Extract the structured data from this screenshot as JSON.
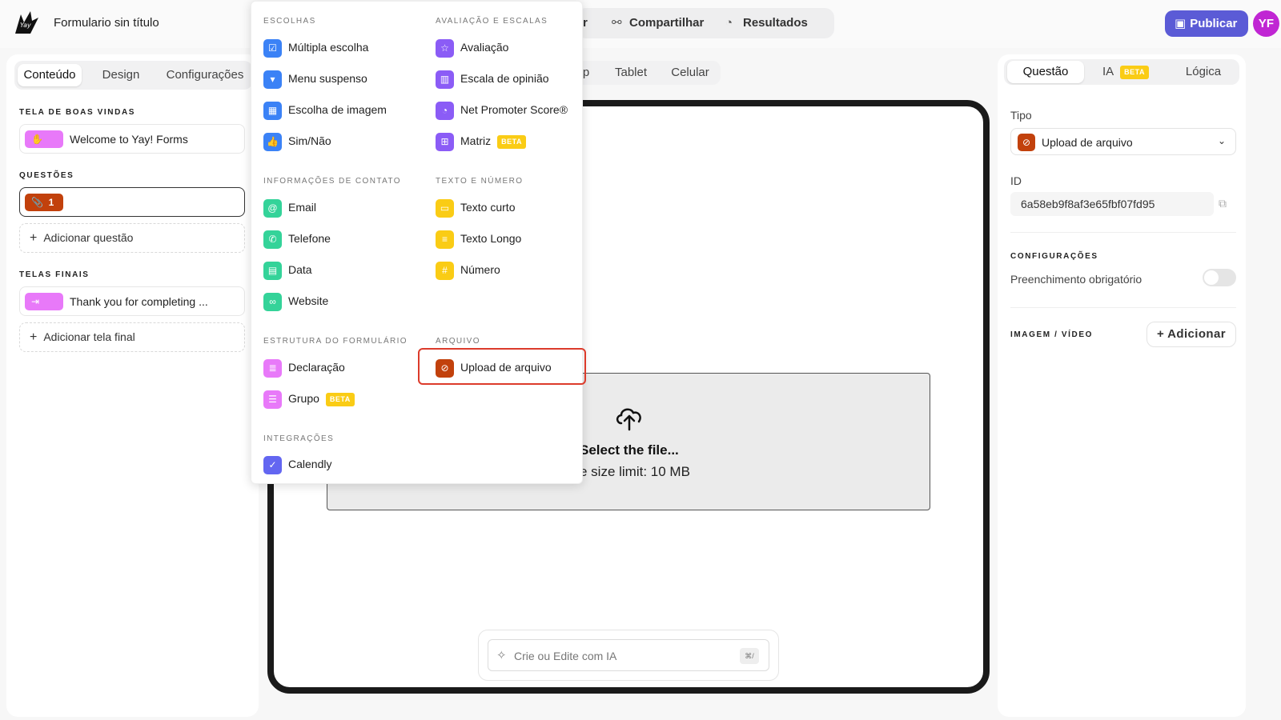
{
  "header": {
    "form_title": "Formulario sin título",
    "nav": [
      {
        "label": "r"
      },
      {
        "label": "Compartilhar",
        "icon": "share-icon"
      },
      {
        "label": "Resultados",
        "icon": "chart-pie-icon"
      }
    ],
    "publish_label": "Publicar",
    "avatar_initials": "YF",
    "accent_color": "#5b5bd6"
  },
  "left": {
    "tabs": [
      "Conteúdo",
      "Design",
      "Configurações"
    ],
    "welcome_label": "TELA DE BOAS VINDAS",
    "welcome_item": "Welcome to Yay! Forms",
    "questions_label": "QUESTÕES",
    "question_number": "1",
    "add_question": "Adicionar questão",
    "final_label": "TELAS FINAIS",
    "final_item": "Thank you for completing ...",
    "add_final": "Adicionar tela final"
  },
  "center": {
    "device_tabs": [
      "p",
      "Tablet",
      "Celular"
    ],
    "upload_title": "Select the file...",
    "upload_limit": "e size limit: 10 MB",
    "ai_placeholder": "Crie ou Edite com IA",
    "ai_shortcut": "⌘/"
  },
  "menu": {
    "sections": {
      "choices": "ESCOLHAS",
      "ratings": "AVALIAÇÃO E ESCALAS",
      "contact": "INFORMAÇÕES DE CONTATO",
      "text_number": "TEXTO E NÚMERO",
      "structure": "ESTRUTURA DO FORMULÁRIO",
      "file": "ARQUIVO",
      "integrations": "INTEGRAÇÕES"
    },
    "items": {
      "multiple_choice": "Múltipla escolha",
      "dropdown": "Menu suspenso",
      "image_choice": "Escolha de imagem",
      "yes_no": "Sim/Não",
      "rating": "Avaliação",
      "opinion_scale": "Escala de opinião",
      "nps": "Net Promoter Score®",
      "matrix": "Matriz",
      "email": "Email",
      "phone": "Telefone",
      "date": "Data",
      "website": "Website",
      "short_text": "Texto curto",
      "long_text": "Texto Longo",
      "number": "Número",
      "statement": "Declaração",
      "group": "Grupo",
      "file_upload": "Upload de arquivo",
      "calendly": "Calendly"
    },
    "beta": "BETA"
  },
  "right": {
    "tabs": [
      "Questão",
      "IA",
      "Lógica"
    ],
    "ai_badge": "BETA",
    "type_label": "Tipo",
    "type_value": "Upload de arquivo",
    "id_label": "ID",
    "id_value": "6a58eb9f8af3e65fbf07fd95",
    "settings_label": "CONFIGURAÇÕES",
    "required_label": "Preenchimento obrigatório",
    "required_value": "off",
    "media_label": "IMAGEM / VÍDEO",
    "add_label": "+ Adicionar"
  }
}
